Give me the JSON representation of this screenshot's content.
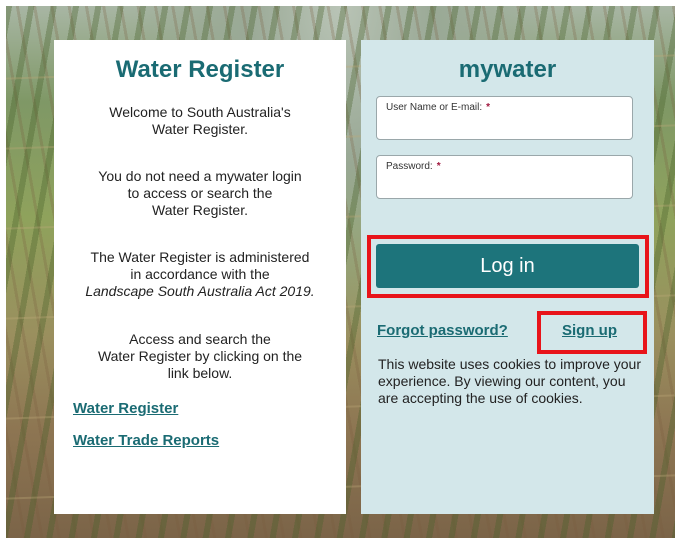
{
  "left_panel": {
    "title": "Water Register",
    "welcome_line1": "Welcome to South Australia's",
    "welcome_line2": "Water Register.",
    "login_note_line1": "You do not need a mywater login",
    "login_note_line2": "to access or search the",
    "login_note_line3": "Water Register.",
    "admin_line1": "The Water Register is administered",
    "admin_line2": "in accordance with the",
    "admin_line3": "Landscape South Australia Act 2019.",
    "access_line1": "Access and search the",
    "access_line2": "Water Register by clicking on the",
    "access_line3": "link below.",
    "link_water_register": "Water Register",
    "link_trade_reports": "Water Trade Reports"
  },
  "right_panel": {
    "title": "mywater",
    "username_label": "User Name or E-mail:",
    "username_value": "",
    "password_label": "Password:",
    "password_value": "",
    "required_mark": "*",
    "login_button": "Log in",
    "forgot_password": "Forgot password?",
    "sign_up": "Sign up",
    "cookie_notice": "This website uses cookies to improve your experience. By viewing our content, you are accepting the use of cookies."
  },
  "colors": {
    "accent": "#1a6b73",
    "button": "#1d747b",
    "right_panel_bg": "#d3e7ea",
    "highlight": "#e8141a",
    "required": "#a0173e"
  }
}
